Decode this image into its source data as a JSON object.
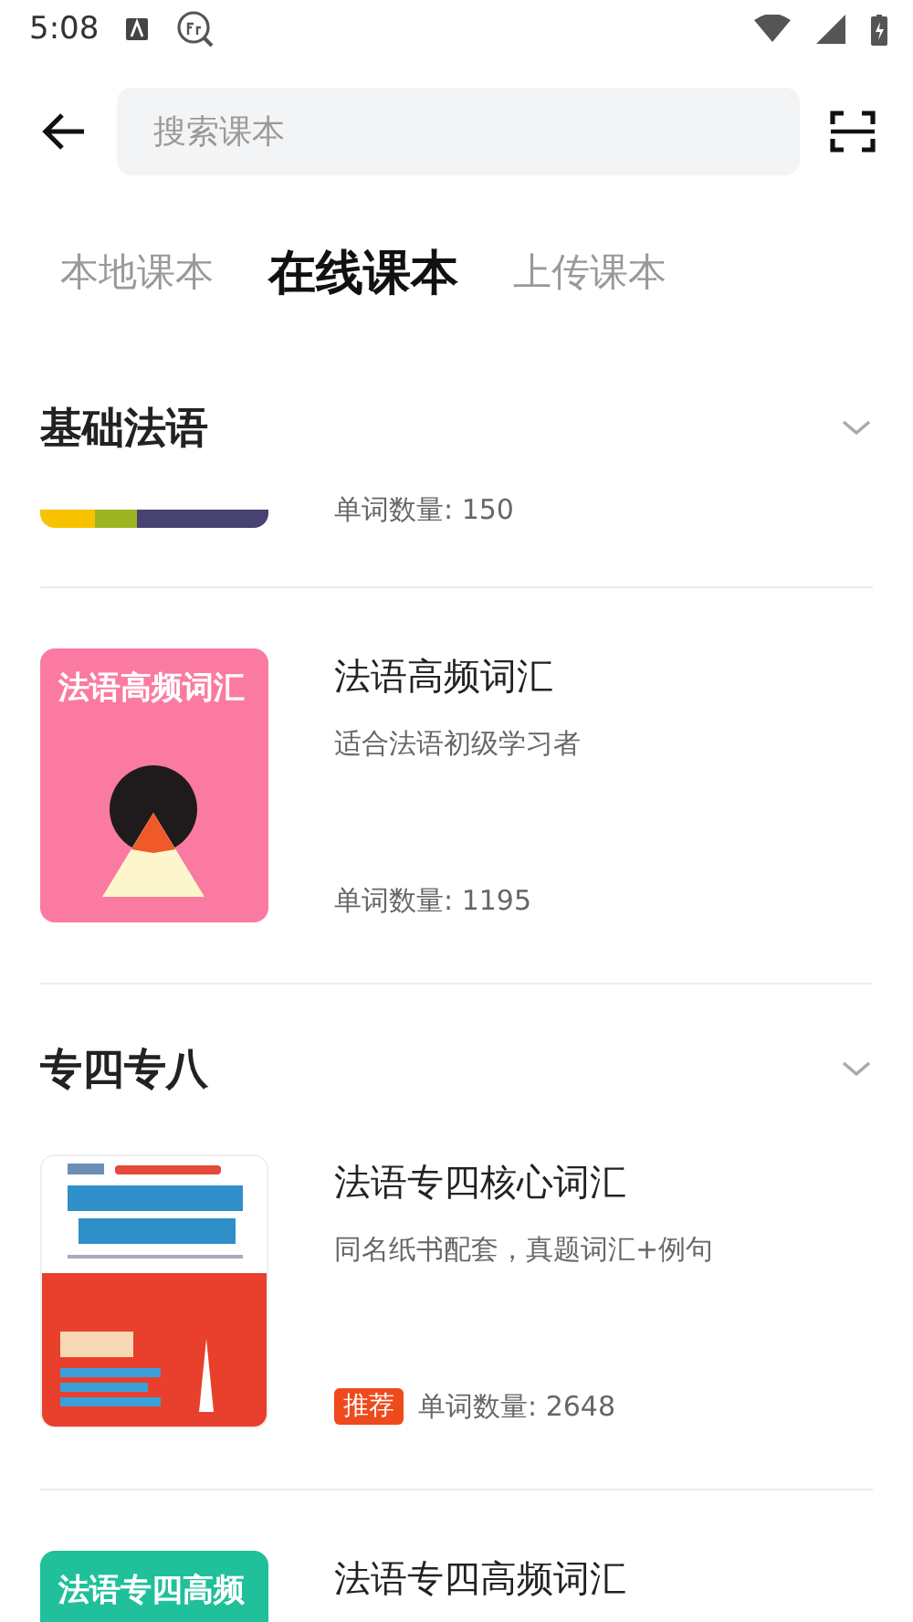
{
  "status_bar": {
    "time": "5:08"
  },
  "search": {
    "placeholder": "搜索课本"
  },
  "tabs": [
    {
      "label": "本地课本",
      "selected": false
    },
    {
      "label": "在线课本",
      "selected": true
    },
    {
      "label": "上传课本",
      "selected": false
    }
  ],
  "sections": [
    {
      "title": "基础法语",
      "books": [
        {
          "kind": "partial",
          "cover": {
            "kind": "stripes"
          },
          "count": "单词数量: 150"
        },
        {
          "kind": "full",
          "cover": {
            "kind": "pink",
            "title": "法语高频词汇"
          },
          "title": "法语高频词汇",
          "subtitle": "适合法语初级学习者",
          "count": "单词数量: 1195"
        }
      ]
    },
    {
      "title": "专四专八",
      "books": [
        {
          "kind": "full",
          "title": "法语专四核心词汇",
          "subtitle": "同名纸书配套，真题词汇+例句",
          "badge": "推荐",
          "count": "单词数量: 2648"
        },
        {
          "kind": "top",
          "cover": {
            "kind": "green",
            "title": "法语专四高频"
          },
          "title": "法语专四高频词汇"
        }
      ]
    }
  ]
}
